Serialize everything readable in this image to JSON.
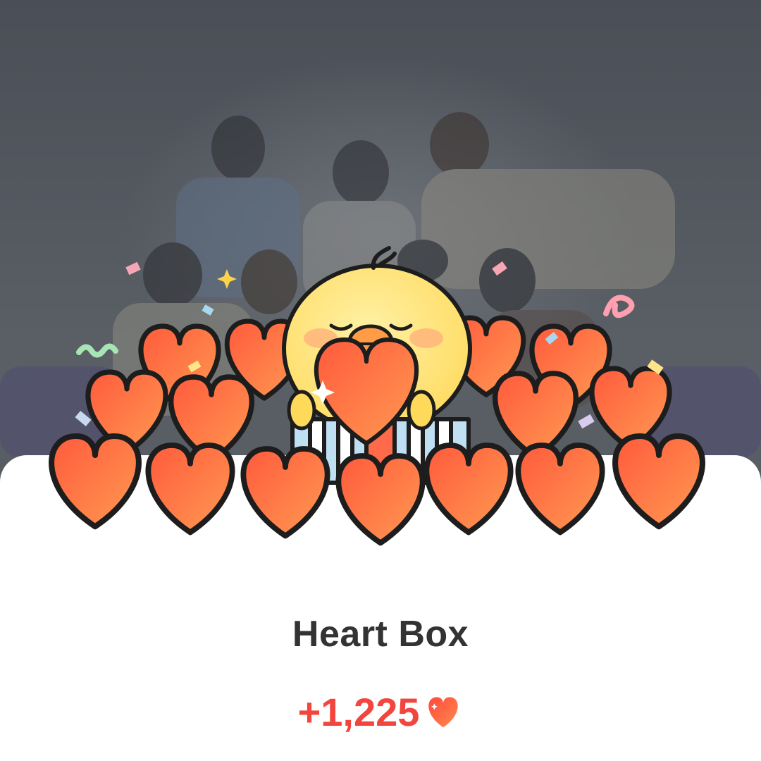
{
  "dialog": {
    "title": "Heart Box",
    "reward_amount": "+1,225"
  },
  "icons": {
    "reward_icon": "heart-icon",
    "mascot": "yellow-chick-mascot"
  },
  "colors": {
    "accent_red": "#f2453d",
    "title_text": "#333333",
    "sheet_background": "#ffffff",
    "backdrop_dim": "#4b5058"
  }
}
